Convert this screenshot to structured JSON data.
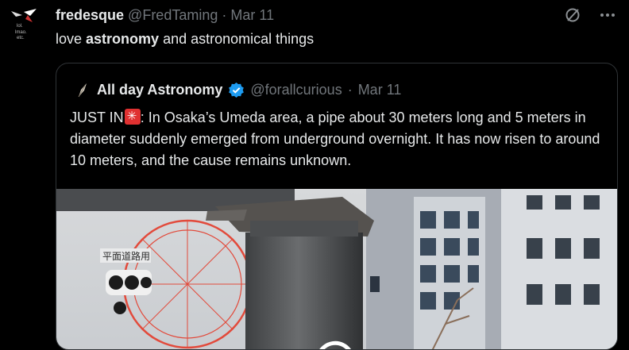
{
  "tweet": {
    "display_name": "fredesque",
    "handle": "@FredTaming",
    "separator": "·",
    "date": "Mar 11",
    "text_before": "love ",
    "text_bold": "astronomy",
    "text_after": " and astronomical things",
    "avatar_text": [
      "lol.",
      "lmao.",
      "etc."
    ]
  },
  "icons": {
    "grok": "grok-icon",
    "more": "more-icon"
  },
  "quote": {
    "display_name": "All day Astronomy",
    "handle": "@forallcurious",
    "separator": "·",
    "date": "Mar 11",
    "text_prefix": "JUST IN",
    "text_body": ": In Osaka’s Umeda area, a pipe about 30 meters long and 5 meters in diameter suddenly emerged from underground overnight. It has now risen to around 10 meters, and the cause remains unknown.",
    "media_sign": "平面道路用"
  },
  "colors": {
    "background": "#000000",
    "text": "#e7e9ea",
    "muted": "#71767b",
    "verified": "#1d9bf0",
    "border": "#2f3336"
  }
}
